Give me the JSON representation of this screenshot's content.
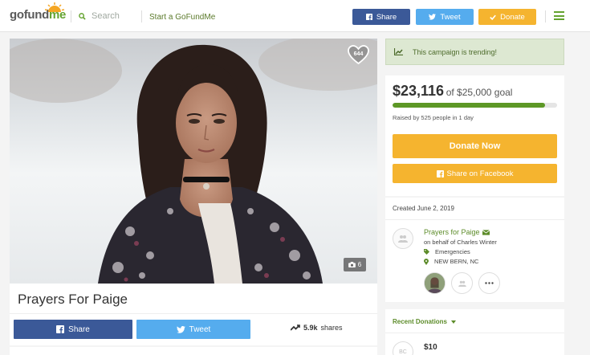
{
  "header": {
    "logo_go": "gofund",
    "logo_me": "me",
    "search_placeholder": "Search",
    "start_link": "Start a GoFundMe",
    "share_label": "Share",
    "tweet_label": "Tweet",
    "donate_label": "Donate"
  },
  "campaign": {
    "hearts": "644",
    "photos": "6",
    "title": "Prayers For Paige",
    "share_label": "Share",
    "tweet_label": "Tweet",
    "shares_count": "5.9k",
    "shares_suffix": "shares"
  },
  "sidebar": {
    "trending": "This campaign is trending!",
    "raised_amount": "$23,116",
    "goal_text": "of $25,000 goal",
    "progress_fraction": 0.925,
    "raised_by": "Raised by 525 people in 1 day",
    "donate_now": "Donate Now",
    "share_facebook": "Share on Facebook",
    "created": "Created June 2, 2019",
    "organizer_name": "Prayers for Paige",
    "on_behalf": "on behalf of Charles Winter",
    "category": "Emergencies",
    "location": "NEW BERN, NC",
    "recent_title": "Recent Donations",
    "donor_initials": "BC",
    "first_donation": "$10"
  },
  "colors": {
    "brand_green": "#64a32f",
    "facebook": "#3b5998",
    "twitter": "#55acee",
    "donate_orange": "#f5b42f"
  }
}
